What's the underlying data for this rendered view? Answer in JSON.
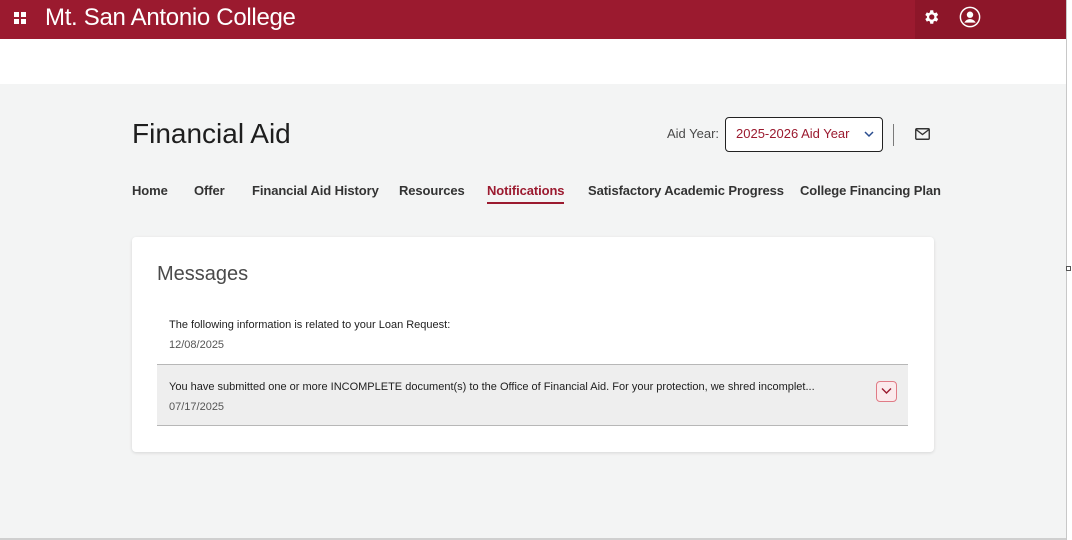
{
  "header": {
    "brand": "Mt. San Antonio College",
    "accent_color": "#9b1a2f",
    "icons": {
      "apps": "apps-grid-icon",
      "settings": "gear-icon",
      "profile": "user-icon"
    }
  },
  "page": {
    "title": "Financial Aid",
    "aid_year_label": "Aid Year:",
    "aid_year_value": "2025-2026 Aid Year",
    "mail_icon": "mail-icon"
  },
  "tabs": [
    {
      "label": "Home",
      "active": false
    },
    {
      "label": "Offer",
      "active": false
    },
    {
      "label": "Financial Aid History",
      "active": false
    },
    {
      "label": "Resources",
      "active": false
    },
    {
      "label": "Notifications",
      "active": true
    },
    {
      "label": "Satisfactory Academic Progress",
      "active": false
    },
    {
      "label": "College Financing Plan",
      "active": false
    }
  ],
  "messages": {
    "title": "Messages",
    "items": [
      {
        "text": "The following information is related to your Loan Request:",
        "date": "12/08/2025"
      },
      {
        "text": "You have submitted one or more INCOMPLETE document(s) to the Office of Financial Aid. For your protection, we shred incomplet...",
        "date": "07/17/2025"
      }
    ]
  }
}
